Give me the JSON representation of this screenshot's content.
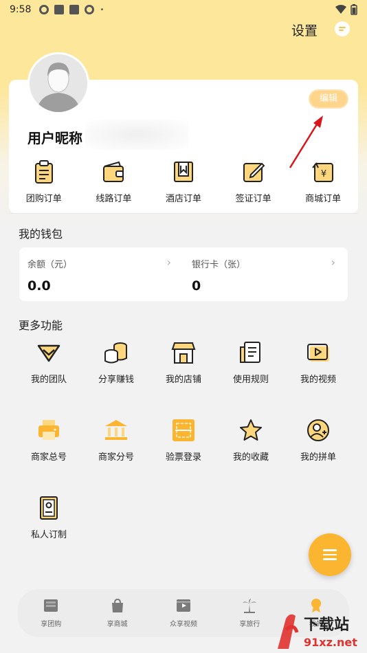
{
  "status_bar": {
    "time": "9:58"
  },
  "header": {
    "settings_label": "设置"
  },
  "profile": {
    "edit_label": "编辑",
    "nickname": "用户昵称"
  },
  "orders": [
    {
      "label": "团购订单",
      "icon": "clipboard-list-icon"
    },
    {
      "label": "线路订单",
      "icon": "wallet-icon"
    },
    {
      "label": "酒店订单",
      "icon": "hotel-icon"
    },
    {
      "label": "签证订单",
      "icon": "pen-edit-icon"
    },
    {
      "label": "商城订单",
      "icon": "yen-refresh-icon"
    }
  ],
  "wallet": {
    "title": "我的钱包",
    "balance_label": "余额（元）",
    "balance_value": "0.0",
    "card_label": "银行卡（张）",
    "card_value": "0"
  },
  "more": {
    "title": "更多功能",
    "items": [
      {
        "label": "我的团队",
        "icon": "diamond-icon"
      },
      {
        "label": "分享赚钱",
        "icon": "coins-icon"
      },
      {
        "label": "我的店铺",
        "icon": "store-icon"
      },
      {
        "label": "使用规则",
        "icon": "document-icon"
      },
      {
        "label": "我的视频",
        "icon": "play-icon"
      },
      {
        "label": "商家总号",
        "icon": "printer-icon"
      },
      {
        "label": "商家分号",
        "icon": "bank-icon"
      },
      {
        "label": "验票登录",
        "icon": "qr-scan-icon"
      },
      {
        "label": "我的收藏",
        "icon": "star-icon"
      },
      {
        "label": "我的拼单",
        "icon": "user-add-icon"
      },
      {
        "label": "私人订制",
        "icon": "id-book-icon"
      }
    ]
  },
  "tabs": [
    {
      "label": "享团购"
    },
    {
      "label": "享商城"
    },
    {
      "label": "众享视频"
    },
    {
      "label": "享旅行"
    },
    {
      "label": "我的"
    }
  ],
  "watermark": {
    "text": "下载站",
    "url_text": "91xz.net"
  },
  "colors": {
    "accent": "#fbb531",
    "header_bg": "#fde79a",
    "icon_fill": "#fdd67d"
  }
}
